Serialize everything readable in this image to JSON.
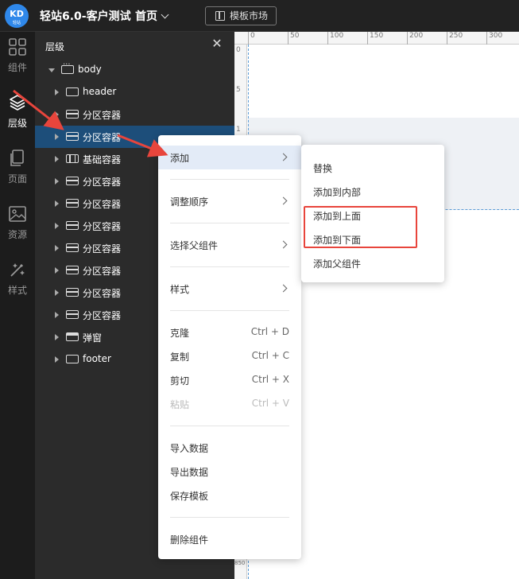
{
  "app": {
    "logo_text": "KD",
    "logo_subtext": "轻站",
    "title": "轻站6.0-客户测试",
    "page_selector": "首页",
    "template_market": "模板市场"
  },
  "rail": [
    {
      "label": "组件",
      "icon": "grid-icon",
      "active": false
    },
    {
      "label": "层级",
      "icon": "layers-icon",
      "active": true
    },
    {
      "label": "页面",
      "icon": "page-icon",
      "active": false
    },
    {
      "label": "资源",
      "icon": "image-icon",
      "active": false
    },
    {
      "label": "样式",
      "icon": "magic-wand-icon",
      "active": false
    }
  ],
  "layers": {
    "title": "层级",
    "close_icon": "close-icon",
    "tree": [
      {
        "label": "body",
        "icon": "body",
        "expanded": true,
        "level": 0
      },
      {
        "label": "header",
        "icon": "box",
        "level": 1
      },
      {
        "label": "分区容器",
        "icon": "section",
        "level": 1
      },
      {
        "label": "分区容器",
        "icon": "section",
        "level": 1,
        "selected": true
      },
      {
        "label": "基础容器",
        "icon": "base",
        "level": 1
      },
      {
        "label": "分区容器",
        "icon": "section",
        "level": 1
      },
      {
        "label": "分区容器",
        "icon": "section",
        "level": 1
      },
      {
        "label": "分区容器",
        "icon": "section",
        "level": 1
      },
      {
        "label": "分区容器",
        "icon": "section",
        "level": 1
      },
      {
        "label": "分区容器",
        "icon": "section",
        "level": 1
      },
      {
        "label": "分区容器",
        "icon": "section",
        "level": 1
      },
      {
        "label": "分区容器",
        "icon": "section",
        "level": 1
      },
      {
        "label": "弹窗",
        "icon": "popup",
        "level": 1
      },
      {
        "label": "footer",
        "icon": "box",
        "level": 1
      }
    ]
  },
  "ruler": {
    "top_labels": [
      "0",
      "50",
      "100",
      "150",
      "200",
      "250",
      "300"
    ],
    "left_labels": [
      "0",
      "5",
      "1",
      "850"
    ]
  },
  "context_menu": {
    "items": [
      {
        "label": "添加",
        "submenu": true,
        "highlighted": true
      },
      {
        "label": "调整顺序",
        "submenu": true
      },
      {
        "label": "选择父组件",
        "submenu": true
      },
      {
        "label": "样式",
        "submenu": true
      },
      {
        "label": "克隆",
        "shortcut": "Ctrl + D"
      },
      {
        "label": "复制",
        "shortcut": "Ctrl + C"
      },
      {
        "label": "剪切",
        "shortcut": "Ctrl + X"
      },
      {
        "label": "粘贴",
        "shortcut": "Ctrl + V",
        "disabled": true
      },
      {
        "label": "导入数据"
      },
      {
        "label": "导出数据"
      },
      {
        "label": "保存模板"
      },
      {
        "label": "删除组件"
      }
    ]
  },
  "submenu": {
    "items": [
      {
        "label": "替换"
      },
      {
        "label": "添加到内部"
      },
      {
        "label": "添加到上面"
      },
      {
        "label": "添加到下面"
      },
      {
        "label": "添加父组件"
      }
    ]
  },
  "colors": {
    "accent": "#2f88ea",
    "selection": "#1d4e7a",
    "annotation": "#e8453c"
  }
}
